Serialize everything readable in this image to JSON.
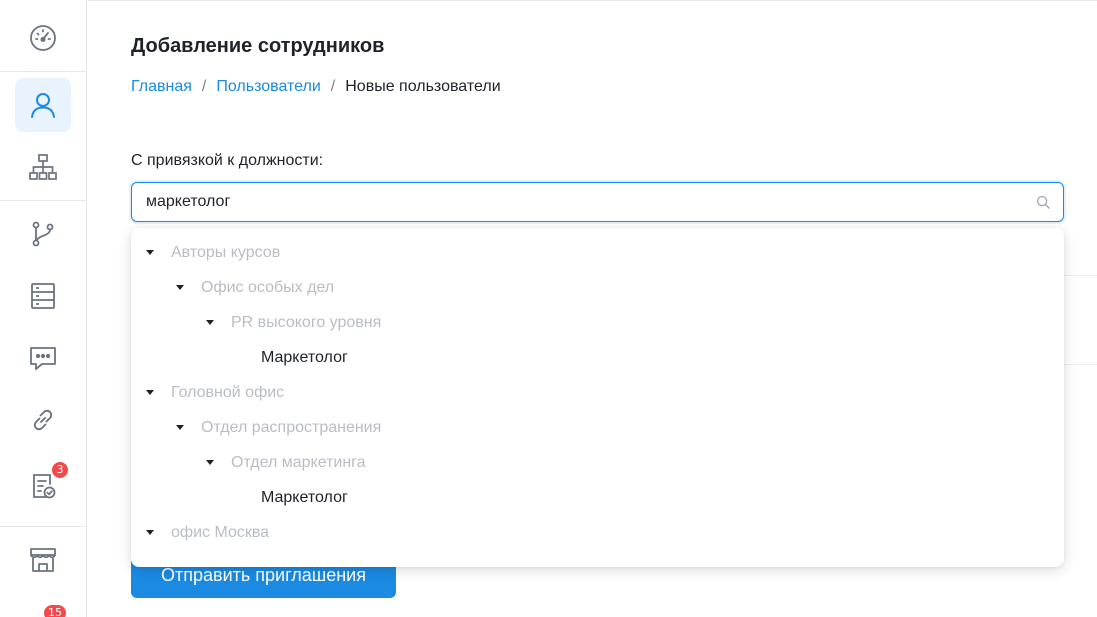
{
  "sidebar": {
    "items": [
      {
        "name": "dashboard",
        "icon": "speedometer-icon"
      },
      {
        "name": "users",
        "icon": "user-icon",
        "active": true
      },
      {
        "name": "structure",
        "icon": "org-chart-icon"
      },
      {
        "name": "flows",
        "icon": "branch-icon"
      },
      {
        "name": "database",
        "icon": "server-icon"
      },
      {
        "name": "chat",
        "icon": "chat-icon"
      },
      {
        "name": "links",
        "icon": "link-icon"
      },
      {
        "name": "tasks",
        "icon": "checklist-icon",
        "badge": "3"
      },
      {
        "name": "store",
        "icon": "store-icon"
      },
      {
        "name": "notifications",
        "badge": "15"
      }
    ]
  },
  "header": {
    "title": "Добавление сотрудников",
    "breadcrumb": [
      "Главная",
      "Пользователи",
      "Новые пользователи"
    ],
    "breadcrumb_sep": "/"
  },
  "form": {
    "position_label": "С привязкой к должности:",
    "search_value": "маркетолог",
    "submit_label": "Отправить приглашения"
  },
  "dropdown": {
    "rows": [
      {
        "label": "Авторы курсов",
        "level": 0,
        "kind": "group"
      },
      {
        "label": "Офис особых дел",
        "level": 1,
        "kind": "group"
      },
      {
        "label": "PR высокого уровня",
        "level": 2,
        "kind": "group"
      },
      {
        "label": "Маркетолог",
        "level": 3,
        "kind": "option"
      },
      {
        "label": "Головной офис",
        "level": 0,
        "kind": "group"
      },
      {
        "label": "Отдел распространения",
        "level": 1,
        "kind": "group"
      },
      {
        "label": "Отдел маркетинга",
        "level": 2,
        "kind": "group"
      },
      {
        "label": "Маркетолог",
        "level": 3,
        "kind": "option"
      },
      {
        "label": "офис Москва",
        "level": 0,
        "kind": "group"
      }
    ]
  },
  "colors": {
    "accent": "#1a8ae3",
    "badge": "#f5484b",
    "disabled_text": "#b9bdc3",
    "active_bg": "#e8f3fd"
  }
}
